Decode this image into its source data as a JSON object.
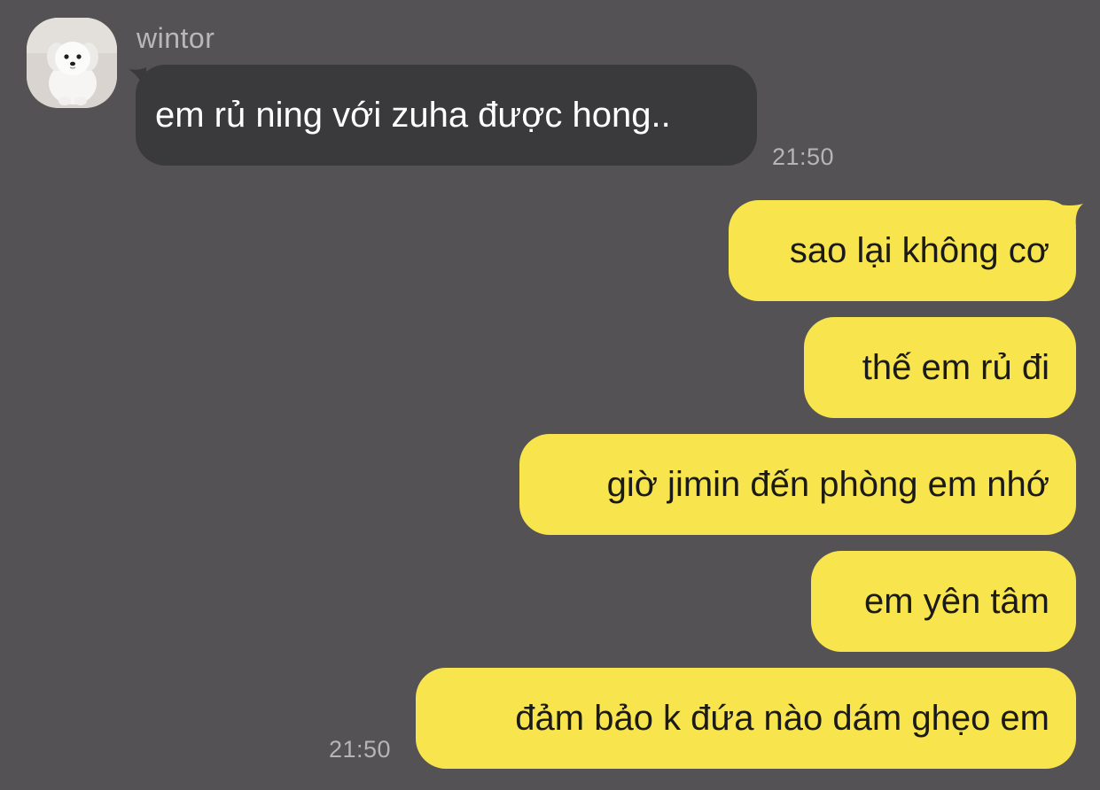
{
  "conversation": {
    "incoming": {
      "sender": "wintor",
      "avatar_icon": "white-dog-avatar",
      "message": "em rủ ning với zuha được hong..",
      "time": "21:50"
    },
    "outgoing": {
      "messages": [
        "sao lại không cơ",
        "thế em rủ đi",
        "giờ jimin đến phòng em nhớ",
        "em yên tâm",
        "đảm bảo k đứa nào dám ghẹo em"
      ],
      "time": "21:50"
    }
  },
  "colors": {
    "background": "#545254",
    "incoming_bubble": "#3a393b",
    "outgoing_bubble": "#f8e44d",
    "meta_text": "#b6b4b6"
  }
}
